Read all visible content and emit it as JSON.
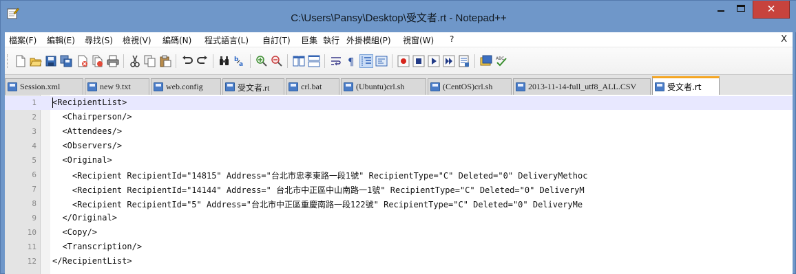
{
  "window": {
    "title": "C:\\Users\\Pansy\\Desktop\\受文者.rt - Notepad++"
  },
  "menu": {
    "items": [
      "檔案(F)",
      "編輯(E)",
      "尋找(S)",
      "檢視(V)",
      "編碼(N)",
      "程式語言(L)",
      "自訂(T)",
      "巨集",
      "執行",
      "外掛模組(P)",
      "視窗(W)",
      "?"
    ],
    "close": "X"
  },
  "toolbar": {
    "icons": [
      "new-file-icon",
      "open-file-icon",
      "save-icon",
      "save-all-icon",
      "close-icon",
      "close-all-icon",
      "print-icon",
      "cut-icon",
      "copy-icon",
      "paste-icon",
      "undo-icon",
      "redo-icon",
      "find-icon",
      "replace-icon",
      "zoom-in-icon",
      "zoom-out-icon",
      "sync-vertical-icon",
      "sync-horizontal-icon",
      "word-wrap-icon",
      "show-all-characters-icon",
      "indent-guide-icon",
      "function-list-icon",
      "record-macro-icon",
      "stop-macro-icon",
      "play-macro-icon",
      "run-macro-multiple-icon",
      "save-macro-icon",
      "doc-map-icon",
      "spell-check-icon"
    ]
  },
  "tabs": [
    {
      "label": "Session.xml",
      "active": false
    },
    {
      "label": "new 9.txt",
      "active": false
    },
    {
      "label": "web.config",
      "active": false
    },
    {
      "label": "受文者.rt",
      "active": false
    },
    {
      "label": "crl.bat",
      "active": false
    },
    {
      "label": "(Ubuntu)crl.sh",
      "active": false
    },
    {
      "label": "(CentOS)crl.sh",
      "active": false
    },
    {
      "label": "2013-11-14-full_utf8_ALL.CSV",
      "active": false
    },
    {
      "label": "受文者.rt",
      "active": true
    }
  ],
  "editor": {
    "current_line": 1,
    "lines": [
      {
        "n": "1",
        "text": "<RecipientList>"
      },
      {
        "n": "2",
        "text": "  <Chairperson/>"
      },
      {
        "n": "3",
        "text": "  <Attendees/>"
      },
      {
        "n": "4",
        "text": "  <Observers/>"
      },
      {
        "n": "5",
        "text": "  <Original>"
      },
      {
        "n": "6",
        "text": "    <Recipient RecipientId=\"14815\" Address=\"台北市忠孝東路一段1號\" RecipientType=\"C\" Deleted=\"0\" DeliveryMethoc"
      },
      {
        "n": "7",
        "text": "    <Recipient RecipientId=\"14144\" Address=\" 台北市中正區中山南路一1號\" RecipientType=\"C\" Deleted=\"0\" DeliveryM"
      },
      {
        "n": "8",
        "text": "    <Recipient RecipientId=\"5\" Address=\"台北市中正區重慶南路一段122號\" RecipientType=\"C\" Deleted=\"0\" DeliveryMe"
      },
      {
        "n": "9",
        "text": "  </Original>"
      },
      {
        "n": "10",
        "text": "  <Copy/>"
      },
      {
        "n": "11",
        "text": "  <Transcription/>"
      },
      {
        "n": "12",
        "text": "</RecipientList>"
      }
    ]
  },
  "colors": {
    "title_bar": "#6f97c9",
    "close_button": "#c7433d",
    "active_tab_accent": "#f5a623",
    "current_line": "#e8e8ff"
  }
}
